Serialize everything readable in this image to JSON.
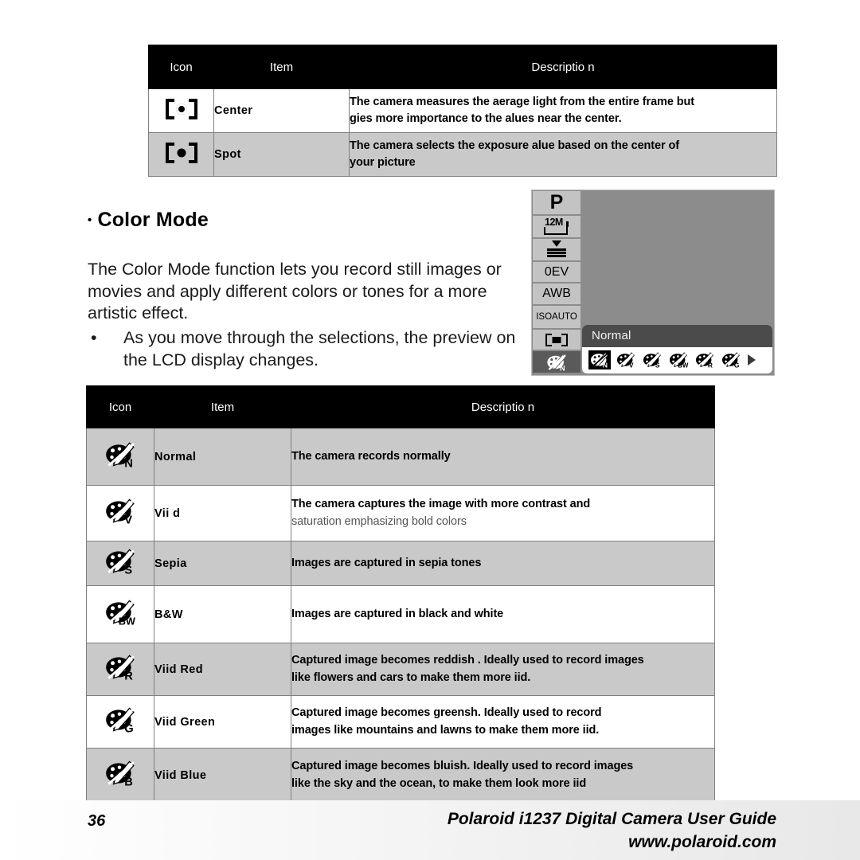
{
  "metering_table": {
    "headers": [
      "Icon",
      "Item",
      "Descriptio  n"
    ],
    "rows": [
      {
        "icon": "metering-center-icon",
        "item": "Center",
        "desc_line1": "The camera measures the aerage   light from the entire frame but",
        "desc_line2": "gies more importance to the alues near the center."
      },
      {
        "icon": "metering-spot-icon",
        "item": "Spot",
        "desc_line1": "The camera selects the exposure alue based on the center of",
        "desc_line2": "your picture"
      }
    ]
  },
  "section": {
    "bullet": "•",
    "heading": "Color Mode",
    "paragraph": "The Color Mode function lets you record still images or movies and apply different colors or tones for a more artistic effect.",
    "bullet_item": "As you move through the selections, the preview on the LCD display changes."
  },
  "lcd": {
    "sidebar": [
      {
        "name": "mode-p-chip",
        "label": "P"
      },
      {
        "name": "resolution-12m-chip",
        "label": "12M"
      },
      {
        "name": "quality-fine-chip",
        "label": ""
      },
      {
        "name": "exposure-ev-chip",
        "label": "0EV"
      },
      {
        "name": "white-balance-chip",
        "label": "AWB"
      },
      {
        "name": "iso-chip",
        "label_line1": "ISO",
        "label_line2": "AUTO"
      },
      {
        "name": "metering-chip",
        "label": ""
      },
      {
        "name": "color-mode-chip",
        "label": "N",
        "selected": true
      }
    ],
    "menu_title": "Normal",
    "menu_options": [
      {
        "letter": "N",
        "active": true
      },
      {
        "letter": "V",
        "active": false
      },
      {
        "letter": "S",
        "active": false
      },
      {
        "letter": "BW",
        "active": false
      },
      {
        "letter": "R",
        "active": false
      },
      {
        "letter": "G",
        "active": false
      }
    ],
    "menu_next_arrow": "chevron-right-icon"
  },
  "colormode_table": {
    "headers": [
      "Icon",
      "Item",
      "Descriptio  n"
    ],
    "rows": [
      {
        "letter": "N",
        "item": "Normal",
        "desc_line1": "The camera records normally",
        "desc_line2": ""
      },
      {
        "letter": "V",
        "item": "Vii  d",
        "desc_line1": "The camera captures the image with more contrast and",
        "desc_line2": "saturation emphasizing bold colors",
        "line2_light": true
      },
      {
        "letter": "S",
        "item": "Sepia",
        "desc_line1": "Images are captured in sepia tones",
        "desc_line2": ""
      },
      {
        "letter": "BW",
        "item": "B&W",
        "desc_line1": "Images are captured in black and white",
        "desc_line2": ""
      },
      {
        "letter": "R",
        "item": "Viid Red",
        "desc_line1": "Captured image becomes reddish . Ideally used to record images",
        "desc_line2": "like flowers and cars to make them more iid."
      },
      {
        "letter": "G",
        "item": "Viid Green",
        "desc_line1": "Captured image becomes greensh. Ideally used to record",
        "desc_line2": "images like mountains and lawns to make them more iid."
      },
      {
        "letter": "B",
        "item": "Viid Blue",
        "desc_line1": "Captured image becomes bluish. Ideally used to record images",
        "desc_line2": "like the sky and the ocean, to make them look more iid"
      }
    ]
  },
  "footer": {
    "page_number": "36",
    "title": "Polaroid i1237 Digital Camera User Guide",
    "url": "www.polaroid.com"
  },
  "colors": {
    "header_bg": "#000000",
    "row_grey": "#c9c9c9",
    "row_white": "#ffffff",
    "lcd_screen": "#8c8c8c",
    "lcd_chip": "#c3c3c3",
    "lcd_chip_selected": "#5a5a5a",
    "lcd_menu_title_bg": "#4b4b4b"
  }
}
